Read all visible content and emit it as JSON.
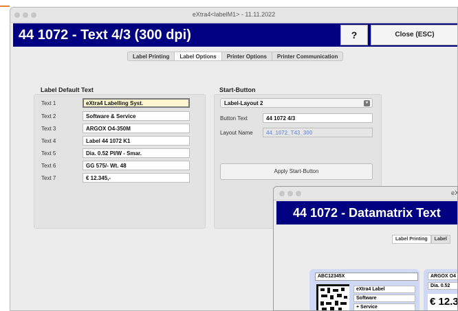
{
  "window": {
    "title": "eXtra4<labelM1> - 11.11.2022",
    "heading": "44 1072 - Text 4/3 (300 dpi)",
    "help_label": "?",
    "close_label": "Close (ESC)"
  },
  "tabs": [
    {
      "label": "Label Printing"
    },
    {
      "label": "Label Options"
    },
    {
      "label": "Printer Options"
    },
    {
      "label": "Printer Communication"
    }
  ],
  "label_default_text": {
    "title": "Label Default Text",
    "rows": [
      {
        "label": "Text 1",
        "value": "eXtra4 Labelling Syst."
      },
      {
        "label": "Text 2",
        "value": "Software & Service"
      },
      {
        "label": "Text 3",
        "value": "ARGOX O4-350M"
      },
      {
        "label": "Text 4",
        "value": "Label 44 1072 K1"
      },
      {
        "label": "Text 5",
        "value": "Dia. 0.52 PI/W - Smar."
      },
      {
        "label": "Text 6",
        "value": "GG 575/- Wt. 48"
      },
      {
        "label": "Text 7",
        "value": "€ 12.345,-"
      }
    ]
  },
  "start_button": {
    "title": "Start-Button",
    "layout_select": "Label-Layout 2",
    "button_text_label": "Button Text",
    "button_text_value": "44 1072 4/3",
    "layout_name_label": "Layout Name",
    "layout_name_value": "44_1072_T43_300",
    "apply_label": "Apply Start-Button"
  },
  "second_window": {
    "title": "eX",
    "heading": "44 1072 - Datamatrix Text",
    "tabs": [
      {
        "label": "Label Printing"
      },
      {
        "label": "Label"
      }
    ],
    "card": {
      "code": "ABC12345X",
      "lines": [
        "eXtra4 Label",
        "Software",
        "+ Service"
      ]
    },
    "card2": {
      "lines": [
        "ARGOX O4",
        "Dia. 0.52"
      ],
      "price": "€ 12.3"
    }
  },
  "colors": {
    "header_bg": "#000080",
    "accent": "#e8812b",
    "label_card_bg": "#cfd8f5"
  }
}
